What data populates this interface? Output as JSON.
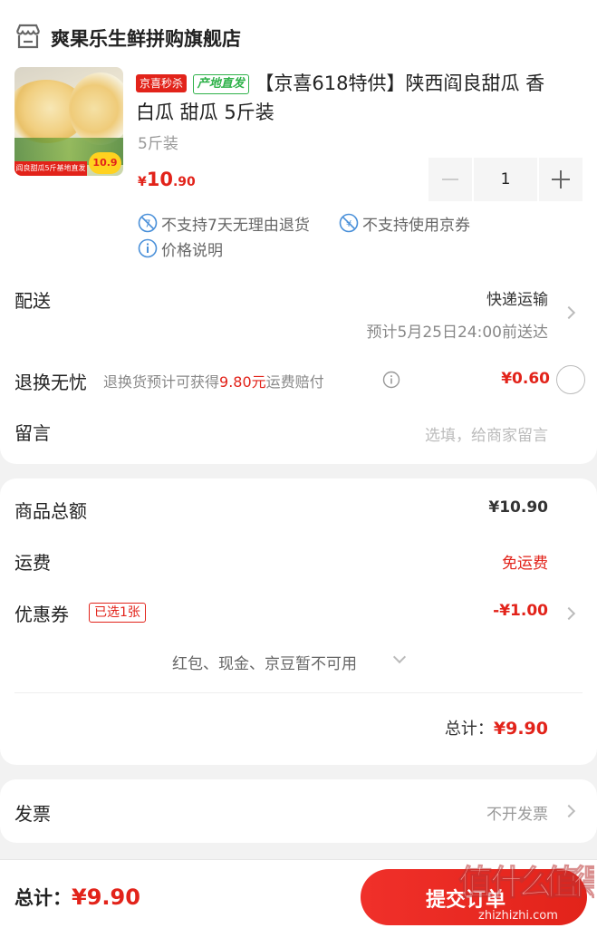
{
  "store": {
    "name": "爽果乐生鲜拼购旗舰店"
  },
  "product": {
    "tag_seckill": "京喜秒杀",
    "tag_origin": "产地直发",
    "title_line1": "【京喜618特供】陕西阎良甜瓜 香",
    "title_line2": "白瓜 甜瓜 5斤装",
    "spec": "5斤装",
    "price_symbol": "¥",
    "price_int": "10",
    "price_dec": ".90",
    "quantity": "1",
    "thumb_caption": "阎良甜瓜5斤基地直发",
    "thumb_price": "10.9",
    "notice_return": "不支持7天无理由退货",
    "notice_coupon": "不支持使用京券",
    "price_explain": "价格说明"
  },
  "delivery": {
    "label": "配送",
    "method": "快递运输",
    "eta": "预计5月25日24:00前送达"
  },
  "insurance": {
    "label": "退换无忧",
    "desc_prefix": "退换货预计可获得",
    "desc_amount": "9.80元",
    "desc_suffix": "运费赔付",
    "price": "¥0.60"
  },
  "message": {
    "label": "留言",
    "placeholder": "选填，给商家留言"
  },
  "summary": {
    "goods_label": "商品总额",
    "goods_value": "¥10.90",
    "freight_label": "运费",
    "freight_value": "免运费",
    "coupon_label": "优惠券",
    "coupon_badge": "已选1张",
    "coupon_value": "-¥1.00",
    "unavailable": "红包、现金、京豆暂不可用",
    "total_label": "总计：",
    "total_value": "¥9.90"
  },
  "invoice": {
    "label": "发票",
    "value": "不开发票"
  },
  "footer": {
    "total_label": "总计：",
    "total_value": "¥9.90",
    "submit": "提交订单"
  },
  "watermark": {
    "text": "值 什么值得买",
    "url": "zhizhizhi.com"
  },
  "colors": {
    "accent": "#e2231a",
    "origin_green": "#2fb24a",
    "page_bg": "#f2f2f2"
  }
}
